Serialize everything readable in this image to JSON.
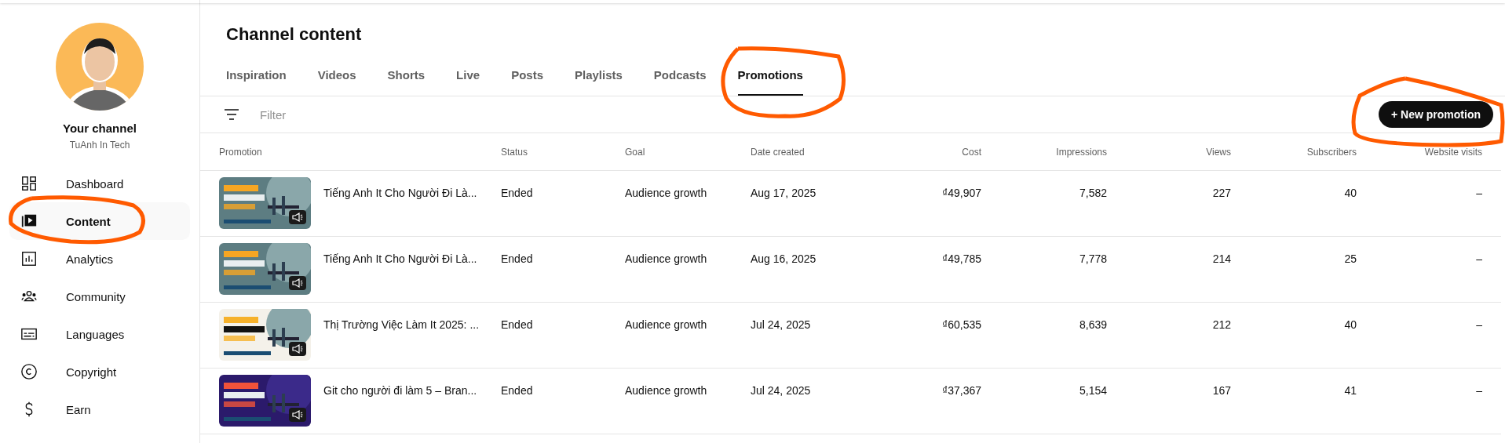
{
  "sidebar": {
    "channel_title": "Your channel",
    "channel_name": "TuAnh In Tech",
    "items": [
      {
        "label": "Dashboard",
        "selected": false
      },
      {
        "label": "Content",
        "selected": true
      },
      {
        "label": "Analytics",
        "selected": false
      },
      {
        "label": "Community",
        "selected": false
      },
      {
        "label": "Languages",
        "selected": false
      },
      {
        "label": "Copyright",
        "selected": false
      },
      {
        "label": "Earn",
        "selected": false
      }
    ]
  },
  "page_title": "Channel content",
  "tabs": [
    {
      "label": "Inspiration",
      "selected": false
    },
    {
      "label": "Videos",
      "selected": false
    },
    {
      "label": "Shorts",
      "selected": false
    },
    {
      "label": "Live",
      "selected": false
    },
    {
      "label": "Posts",
      "selected": false
    },
    {
      "label": "Playlists",
      "selected": false
    },
    {
      "label": "Podcasts",
      "selected": false
    },
    {
      "label": "Promotions",
      "selected": true
    }
  ],
  "filter": {
    "placeholder": "Filter"
  },
  "new_button": "+ New promotion",
  "table": {
    "columns": [
      "Promotion",
      "Status",
      "Goal",
      "Date created",
      "Cost",
      "Impressions",
      "Views",
      "Subscribers",
      "Website visits"
    ],
    "rows": [
      {
        "title": "Tiếng Anh It Cho Người Đi Là...",
        "status": "Ended",
        "goal": "Audience growth",
        "date": "Aug 17, 2025",
        "cost": "₫49,907",
        "impressions": "7,582",
        "views": "227",
        "subscribers": "40",
        "website_visits": "–"
      },
      {
        "title": "Tiếng Anh It Cho Người Đi Là...",
        "status": "Ended",
        "goal": "Audience growth",
        "date": "Aug 16, 2025",
        "cost": "₫49,785",
        "impressions": "7,778",
        "views": "214",
        "subscribers": "25",
        "website_visits": "–"
      },
      {
        "title": "Thị Trường Việc Làm It 2025: ...",
        "status": "Ended",
        "goal": "Audience growth",
        "date": "Jul 24, 2025",
        "cost": "₫60,535",
        "impressions": "8,639",
        "views": "212",
        "subscribers": "40",
        "website_visits": "–"
      },
      {
        "title": "Git cho người đi làm 5 – Bran...",
        "status": "Ended",
        "goal": "Audience growth",
        "date": "Jul 24, 2025",
        "cost": "₫37,367",
        "impressions": "5,154",
        "views": "167",
        "subscribers": "41",
        "website_visits": "–"
      }
    ]
  }
}
